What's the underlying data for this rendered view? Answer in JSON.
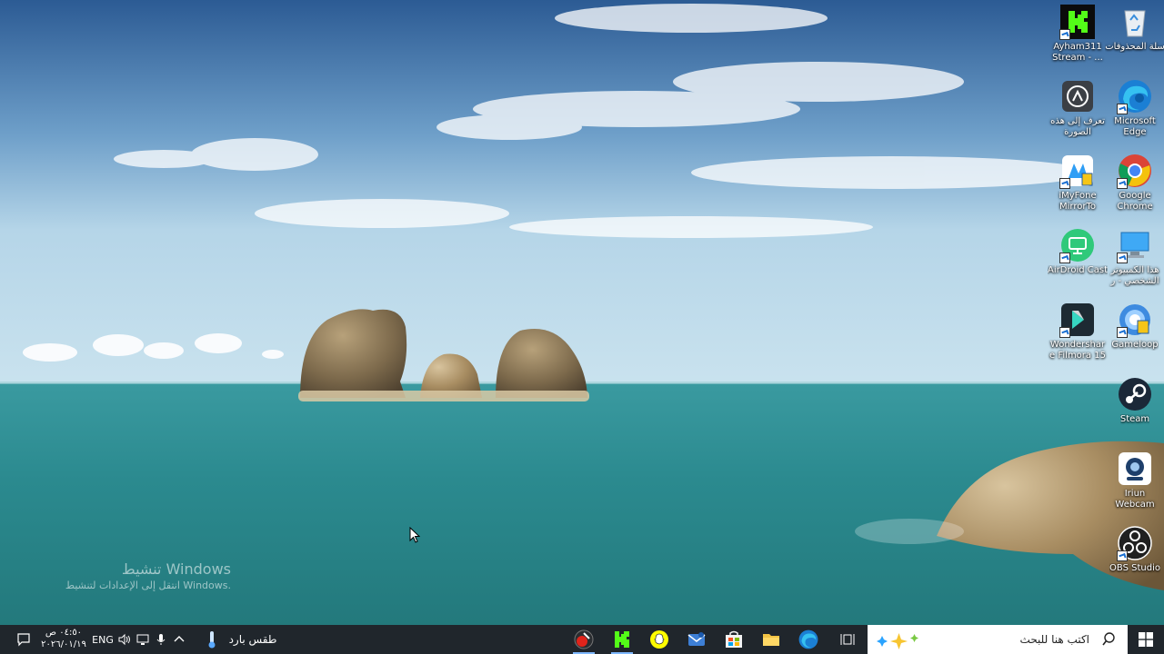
{
  "desktop": {
    "icons_right": [
      {
        "label": "سلة المحذوفات",
        "icon": "recycle-bin-icon"
      },
      {
        "label": "Microsoft Edge",
        "icon": "edge-icon"
      },
      {
        "label": "Google Chrome",
        "icon": "chrome-icon"
      },
      {
        "label": "هذا الكمبيوتر الشخصي - ر",
        "icon": "this-pc-icon"
      },
      {
        "label": "Gameloop",
        "icon": "gameloop-icon"
      },
      {
        "label": "Steam",
        "icon": "steam-icon"
      },
      {
        "label": "Iriun Webcam",
        "icon": "iriun-webcam-icon"
      },
      {
        "label": "OBS Studio",
        "icon": "obs-icon"
      }
    ],
    "icons_left": [
      {
        "label": "Ayham311 Stream - ...",
        "icon": "kick-icon"
      },
      {
        "label": "تعرف إلى هذه الصورة",
        "icon": "learn-about-picture-icon"
      },
      {
        "label": "iMyFone MirrorTo",
        "icon": "imyfone-mirrorto-icon"
      },
      {
        "label": "AirDroid Cast",
        "icon": "airdroid-cast-icon"
      },
      {
        "label": "Wondershare Filmora 15",
        "icon": "filmora-icon"
      }
    ],
    "watermark": {
      "title": "تنشيط Windows",
      "subtitle": "انتقل إلى الإعدادات لتنشيط Windows."
    }
  },
  "taskbar": {
    "start_icon": "windows-logo-icon",
    "search_placeholder": "اكتب هنا للبحث",
    "apps": [
      {
        "name": "task-view-icon"
      },
      {
        "name": "edge-icon"
      },
      {
        "name": "file-explorer-icon"
      },
      {
        "name": "microsoft-store-icon"
      },
      {
        "name": "mail-icon"
      },
      {
        "name": "snapchat-icon"
      },
      {
        "name": "kick-icon"
      },
      {
        "name": "record-app-icon"
      }
    ],
    "weather": "طقس بارد",
    "language": "ENG",
    "clock": {
      "time": "٠٤:٥٠ ص",
      "date": "٢٠٢٦/٠١/١٩"
    }
  },
  "colors": {
    "taskbar_bg": "#20262c",
    "search_bg": "#ffffff",
    "kick_green": "#53fc18"
  }
}
